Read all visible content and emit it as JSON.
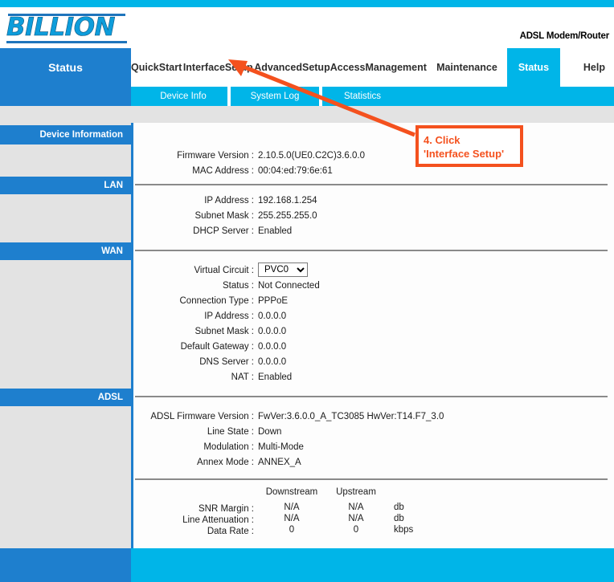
{
  "header": {
    "logo_text": "BILLION",
    "model_label": "ADSL Modem/Router"
  },
  "nav": {
    "section_title": "Status",
    "tabs": [
      {
        "label": "Quick\nStart",
        "active": false
      },
      {
        "label": "Interface\nSetup",
        "active": false
      },
      {
        "label": "Advanced\nSetup",
        "active": false
      },
      {
        "label": "Access\nManagement",
        "active": false
      },
      {
        "label": "Maintenance",
        "active": false
      },
      {
        "label": "Status",
        "active": true
      },
      {
        "label": "Help",
        "active": false
      }
    ],
    "subtabs": [
      {
        "label": "Device Info",
        "active": true
      },
      {
        "label": "System Log",
        "active": false
      },
      {
        "label": "Statistics",
        "active": false
      }
    ]
  },
  "sections": {
    "device_information": {
      "heading": "Device Information",
      "rows": [
        {
          "label": "Firmware Version :",
          "value": "2.10.5.0(UE0.C2C)3.6.0.0"
        },
        {
          "label": "MAC Address :",
          "value": "00:04:ed:79:6e:61"
        }
      ]
    },
    "lan": {
      "heading": "LAN",
      "rows": [
        {
          "label": "IP Address :",
          "value": "192.168.1.254"
        },
        {
          "label": "Subnet Mask :",
          "value": "255.255.255.0"
        },
        {
          "label": "DHCP Server :",
          "value": "Enabled"
        }
      ]
    },
    "wan": {
      "heading": "WAN",
      "virtual_circuit_label": "Virtual Circuit :",
      "virtual_circuit_value": "PVC0",
      "virtual_circuit_options": [
        "PVC0"
      ],
      "rows": [
        {
          "label": "Status :",
          "value": "Not Connected"
        },
        {
          "label": "Connection Type :",
          "value": "PPPoE"
        },
        {
          "label": "IP Address :",
          "value": "0.0.0.0"
        },
        {
          "label": "Subnet Mask :",
          "value": "0.0.0.0"
        },
        {
          "label": "Default Gateway :",
          "value": "0.0.0.0"
        },
        {
          "label": "DNS Server :",
          "value": "0.0.0.0"
        },
        {
          "label": "NAT :",
          "value": "Enabled"
        }
      ]
    },
    "adsl": {
      "heading": "ADSL",
      "rows": [
        {
          "label": "ADSL Firmware Version :",
          "value": "FwVer:3.6.0.0_A_TC3085 HwVer:T14.F7_3.0"
        },
        {
          "label": "Line State :",
          "value": "Down"
        },
        {
          "label": "Modulation :",
          "value": "Multi-Mode"
        },
        {
          "label": "Annex Mode :",
          "value": "ANNEX_A"
        }
      ],
      "stats": {
        "col_headers": [
          "Downstream",
          "Upstream"
        ],
        "rows": [
          {
            "label": "SNR Margin :",
            "downstream": "N/A",
            "upstream": "N/A",
            "unit": "db"
          },
          {
            "label": "Line Attenuation :",
            "downstream": "N/A",
            "upstream": "N/A",
            "unit": "db"
          },
          {
            "label": "Data Rate :",
            "downstream": "0",
            "upstream": "0",
            "unit": "kbps"
          }
        ]
      }
    }
  },
  "annotation": {
    "line1": "4. Click",
    "line2": "'Interface Setup'",
    "color": "#f4511e"
  },
  "colors": {
    "brand_blue": "#1e7fce",
    "cyan": "#00b5e8",
    "gray_panel": "#e3e3e3",
    "rule_gray": "#8a8a8a",
    "annotation_orange": "#f4511e"
  }
}
